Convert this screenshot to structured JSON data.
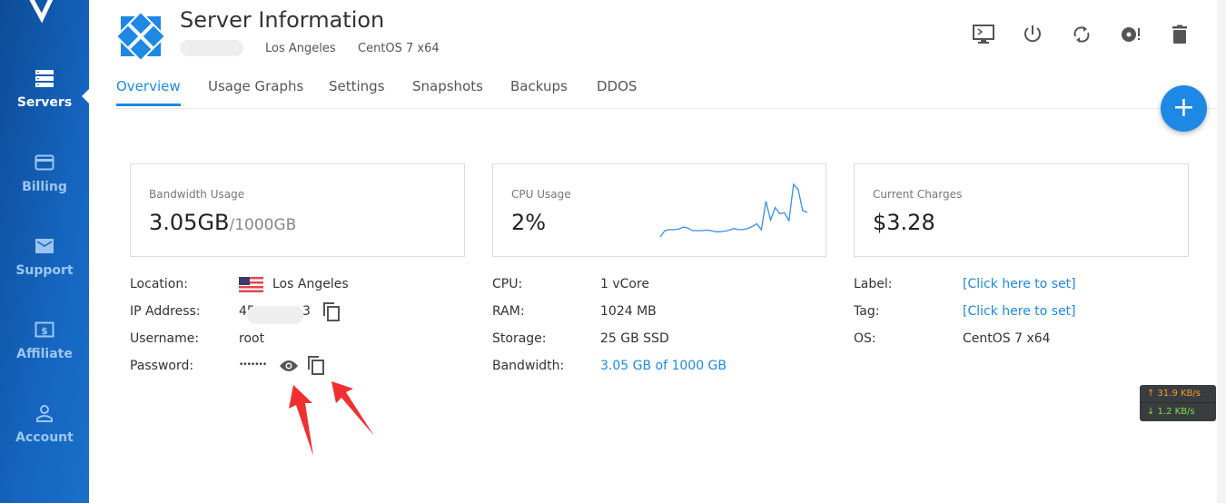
{
  "sidebar": {
    "items": [
      {
        "label": "Servers",
        "icon": "server-icon",
        "active": true
      },
      {
        "label": "Billing",
        "icon": "credit-card-icon"
      },
      {
        "label": "Support",
        "icon": "envelope-icon"
      },
      {
        "label": "Affiliate",
        "icon": "dollar-icon"
      },
      {
        "label": "Account",
        "icon": "user-icon"
      }
    ]
  },
  "header": {
    "title": "Server Information",
    "location": "Los Angeles",
    "os": "CentOS 7 x64",
    "actions": [
      "console-icon",
      "power-icon",
      "restart-icon",
      "reinstall-icon",
      "trash-icon"
    ]
  },
  "tabs": [
    "Overview",
    "Usage Graphs",
    "Settings",
    "Snapshots",
    "Backups",
    "DDOS"
  ],
  "cards": {
    "bandwidth": {
      "label": "Bandwidth Usage",
      "value": "3.05GB",
      "limit": "/1000GB"
    },
    "cpu": {
      "label": "CPU Usage",
      "value": "2%",
      "sparkline": [
        0,
        12,
        14,
        14,
        15,
        19,
        17,
        12,
        12,
        12,
        13,
        12,
        10,
        10,
        11,
        13,
        16,
        14,
        14,
        16,
        20,
        25,
        14,
        68,
        32,
        56,
        44,
        46,
        31,
        100,
        90,
        50,
        47
      ]
    },
    "charges": {
      "label": "Current Charges",
      "value": "$3.28"
    }
  },
  "details": {
    "left": [
      {
        "k": "Location:",
        "v": "Los Angeles"
      },
      {
        "k": "IP Address:",
        "v_start": "45",
        "v_end": "3"
      },
      {
        "k": "Username:",
        "v": "root"
      },
      {
        "k": "Password:",
        "v": "•••••••"
      }
    ],
    "middle": [
      {
        "k": "CPU:",
        "v": "1 vCore"
      },
      {
        "k": "RAM:",
        "v": "1024 MB"
      },
      {
        "k": "Storage:",
        "v": "25 GB SSD"
      },
      {
        "k": "Bandwidth:",
        "v": "3.05 GB of 1000 GB"
      }
    ],
    "right": [
      {
        "k": "Label:",
        "v": "[Click here to set]"
      },
      {
        "k": "Tag:",
        "v": "[Click here to set]"
      },
      {
        "k": "OS:",
        "v": "CentOS 7 x64"
      }
    ]
  },
  "speed": {
    "up": "↑ 31.9 KB/s",
    "down": "↓ 1.2 KB/s"
  },
  "colors": {
    "accent": "#1e88e5",
    "sidebar": "#1565c0",
    "annotation": "#f03030"
  }
}
